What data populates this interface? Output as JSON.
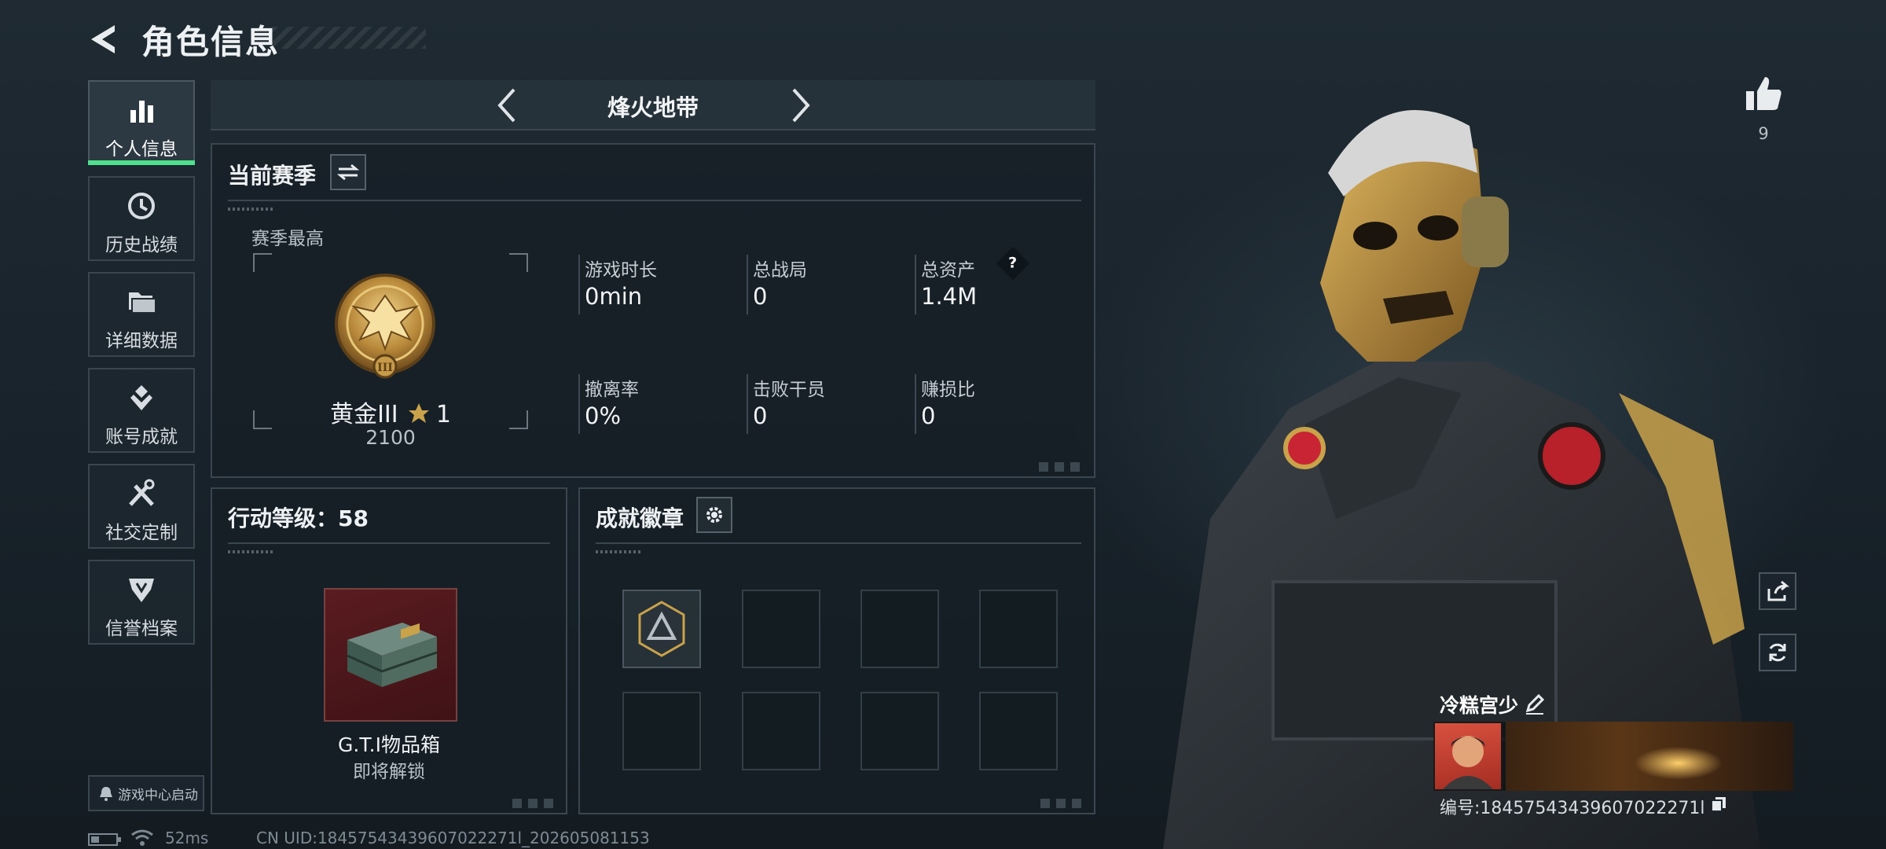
{
  "header": {
    "title": "角色信息"
  },
  "sidebar": {
    "items": [
      {
        "label": "个人信息",
        "icon": "bar-chart-icon",
        "active": true
      },
      {
        "label": "历史战绩",
        "icon": "clock-icon"
      },
      {
        "label": "详细数据",
        "icon": "folder-icon"
      },
      {
        "label": "账号成就",
        "icon": "achievement-icon"
      },
      {
        "label": "社交定制",
        "icon": "tools-icon"
      },
      {
        "label": "信誉档案",
        "icon": "reputation-icon"
      }
    ],
    "game_center": "游戏中心启动"
  },
  "mode": {
    "label": "烽火地带"
  },
  "season": {
    "title": "当前赛季",
    "best_label": "赛季最高",
    "rank_name": "黄金III",
    "rank_stars": "1",
    "rank_score": "2100",
    "stats": [
      {
        "label": "游戏时长",
        "value": "0min"
      },
      {
        "label": "总战局",
        "value": "0"
      },
      {
        "label": "总资产",
        "value": "1.4M",
        "help": "?"
      },
      {
        "label": "撤离率",
        "value": "0%"
      },
      {
        "label": "击败干员",
        "value": "0"
      },
      {
        "label": "赚损比",
        "value": "0"
      }
    ]
  },
  "action_level": {
    "title": "行动等级：58",
    "reward_name": "G.T.I物品箱",
    "reward_status": "即将解锁"
  },
  "achievements": {
    "title": "成就徽章",
    "slots": 8,
    "filled_slots": 1
  },
  "status_bar": {
    "ping": "52ms",
    "uid": "CN UID:18457543439607022271l_202605081153"
  },
  "profile": {
    "likes": "9",
    "player_name": "冷糕宫少",
    "player_id": "编号:18457543439607022271l"
  },
  "colors": {
    "accent_green": "#4fe08d",
    "panel_border": "#3a464f",
    "gold": "#c9a24a"
  }
}
